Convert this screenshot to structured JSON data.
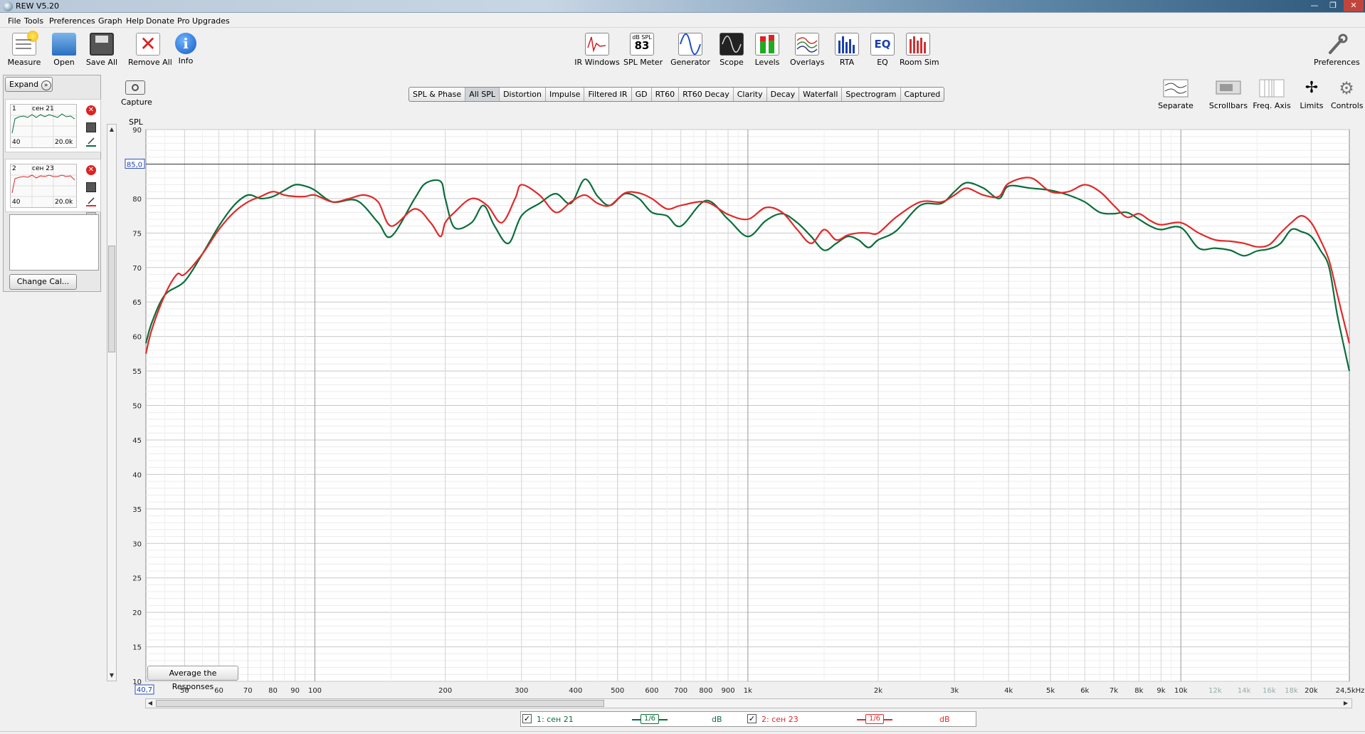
{
  "window": {
    "title": "REW V5.20"
  },
  "menu": [
    "File",
    "Tools",
    "Preferences",
    "Graph",
    "Help",
    "Donate",
    "Pro Upgrades"
  ],
  "toolbar": {
    "left": [
      "Measure",
      "Open",
      "Save All",
      "Remove All",
      "Info"
    ],
    "center": [
      "IR Windows",
      "SPL Meter",
      "Generator",
      "Scope",
      "Levels",
      "Overlays",
      "RTA",
      "EQ",
      "Room Sim"
    ],
    "right": "Preferences",
    "spl_meter_badge": {
      "top": "dB SPL",
      "value": "83"
    }
  },
  "side": {
    "expand": "Expand",
    "measurements": [
      {
        "num": "1",
        "name": "сен 21",
        "xmin": "40",
        "xmax": "20.0k",
        "color": "#0a6e3c"
      },
      {
        "num": "2",
        "name": "сен 23",
        "xmin": "40",
        "xmax": "20.0k",
        "color": "#e02a2a"
      }
    ],
    "change_cal": "Change Cal..."
  },
  "capture": "Capture",
  "tabs": [
    "SPL & Phase",
    "All SPL",
    "Distortion",
    "Impulse",
    "Filtered IR",
    "GD",
    "RT60",
    "RT60 Decay",
    "Clarity",
    "Decay",
    "Waterfall",
    "Spectrogram",
    "Captured"
  ],
  "active_tab": "All SPL",
  "graph_controls": [
    "Separate",
    "Scrollbars",
    "Freq. Axis",
    "Limits",
    "Controls"
  ],
  "avg_button": "Average the Responses",
  "legend": [
    {
      "check": "✓",
      "label": "1: сен 21",
      "smooth": "1/6",
      "unit": "dB",
      "color": "#0a6e3c"
    },
    {
      "check": "✓",
      "label": "2: сен 23",
      "smooth": "1/6",
      "unit": "dB",
      "color": "#e02a2a"
    }
  ],
  "chart_data": {
    "type": "line",
    "ylabel": "SPL",
    "xlim": [
      40.7,
      24500
    ],
    "ylim": [
      10,
      90
    ],
    "x_scale": "log",
    "x_cursor_label": "40,7",
    "y_cursor_label": "85,0",
    "y_cursor_value": 85,
    "xunit_label": "24,5kHz",
    "yticks": [
      10,
      15,
      20,
      25,
      30,
      35,
      40,
      45,
      50,
      55,
      60,
      65,
      70,
      75,
      80,
      85,
      90
    ],
    "xticks": [
      {
        "v": 50,
        "t": "50"
      },
      {
        "v": 60,
        "t": "60"
      },
      {
        "v": 70,
        "t": "70"
      },
      {
        "v": 80,
        "t": "80"
      },
      {
        "v": 90,
        "t": "90"
      },
      {
        "v": 100,
        "t": "100"
      },
      {
        "v": 200,
        "t": "200"
      },
      {
        "v": 300,
        "t": "300"
      },
      {
        "v": 400,
        "t": "400"
      },
      {
        "v": 500,
        "t": "500"
      },
      {
        "v": 600,
        "t": "600"
      },
      {
        "v": 700,
        "t": "700"
      },
      {
        "v": 800,
        "t": "800"
      },
      {
        "v": 900,
        "t": "900"
      },
      {
        "v": 1000,
        "t": "1k"
      },
      {
        "v": 2000,
        "t": "2k"
      },
      {
        "v": 3000,
        "t": "3k"
      },
      {
        "v": 4000,
        "t": "4k"
      },
      {
        "v": 5000,
        "t": "5k"
      },
      {
        "v": 6000,
        "t": "6k"
      },
      {
        "v": 7000,
        "t": "7k"
      },
      {
        "v": 8000,
        "t": "8k"
      },
      {
        "v": 9000,
        "t": "9k"
      },
      {
        "v": 10000,
        "t": "10k"
      },
      {
        "v": 12000,
        "t": "12k",
        "dim": true
      },
      {
        "v": 14000,
        "t": "14k",
        "dim": true
      },
      {
        "v": 16000,
        "t": "16k",
        "dim": true
      },
      {
        "v": 18000,
        "t": "18k",
        "dim": true
      },
      {
        "v": 20000,
        "t": "20k"
      }
    ],
    "series": [
      {
        "name": "1: сен 21",
        "color": "#0a6e3c",
        "x": [
          40.7,
          42,
          45,
          50,
          55,
          60,
          65,
          70,
          75,
          80,
          85,
          90,
          95,
          100,
          110,
          125,
          140,
          150,
          170,
          180,
          195,
          200,
          210,
          230,
          245,
          260,
          280,
          300,
          330,
          360,
          390,
          420,
          450,
          480,
          520,
          560,
          600,
          650,
          700,
          800,
          900,
          1000,
          1100,
          1200,
          1300,
          1400,
          1500,
          1600,
          1700,
          1800,
          1900,
          2000,
          2200,
          2500,
          2800,
          3000,
          3200,
          3500,
          3800,
          4000,
          4500,
          5000,
          5500,
          6000,
          6500,
          7000,
          7500,
          8000,
          8500,
          9000,
          10000,
          11000,
          12000,
          13000,
          14000,
          15000,
          16000,
          17000,
          18000,
          19000,
          20000,
          21000,
          22000,
          23000,
          24500
        ],
        "y": [
          59,
          62,
          66,
          68,
          72,
          76,
          79,
          80.5,
          80,
          80.3,
          81.2,
          82,
          81.8,
          81.2,
          79.5,
          79.7,
          76.5,
          74.5,
          80,
          82.2,
          82.5,
          80,
          75.8,
          76.5,
          79,
          76,
          73.5,
          77.5,
          79.3,
          80.7,
          79.3,
          82.8,
          80.3,
          79,
          80.7,
          80,
          78,
          77.5,
          76,
          79.7,
          77,
          74.5,
          76.8,
          77.8,
          76.5,
          74.5,
          72.5,
          73.5,
          74.5,
          74,
          72.9,
          74,
          75.3,
          79,
          79.3,
          81,
          82.3,
          81.5,
          80,
          81.8,
          81.5,
          81.2,
          80.5,
          79.5,
          78,
          77.8,
          78,
          77,
          76,
          75.5,
          75.8,
          72.8,
          72.8,
          72.5,
          71.7,
          72.4,
          72.7,
          73.5,
          75.5,
          75.2,
          74.5,
          72.5,
          70,
          63,
          55
        ]
      },
      {
        "name": "2: сен 23",
        "color": "#e02a2a",
        "x": [
          40.7,
          42,
          45,
          48,
          50,
          55,
          60,
          65,
          70,
          75,
          80,
          85,
          90,
          95,
          100,
          110,
          120,
          130,
          140,
          150,
          170,
          185,
          195,
          200,
          210,
          230,
          250,
          270,
          290,
          300,
          330,
          360,
          390,
          420,
          450,
          480,
          520,
          560,
          600,
          650,
          700,
          800,
          900,
          1000,
          1100,
          1200,
          1300,
          1400,
          1500,
          1600,
          1700,
          1800,
          1900,
          2000,
          2200,
          2500,
          2800,
          3000,
          3200,
          3500,
          3800,
          4000,
          4500,
          5000,
          5500,
          6000,
          6500,
          7000,
          7500,
          8000,
          8500,
          9000,
          10000,
          11000,
          12000,
          13000,
          14000,
          15000,
          16000,
          17000,
          18000,
          19000,
          20000,
          21000,
          22000,
          23000,
          24500
        ],
        "y": [
          57.5,
          61,
          66,
          69,
          69,
          72,
          75.5,
          78,
          79.5,
          80.3,
          81,
          80.5,
          80.3,
          80.3,
          80.5,
          79.5,
          80,
          80.5,
          79.5,
          76,
          78.5,
          76.5,
          74.5,
          76.5,
          78,
          80,
          79,
          76.5,
          80,
          82,
          80.5,
          78,
          79.5,
          80.5,
          79.3,
          79,
          80.8,
          80.8,
          80,
          78.5,
          79,
          79.5,
          77.7,
          77,
          78.7,
          78,
          75.5,
          73.5,
          75.5,
          74,
          74.7,
          75,
          75,
          75,
          77.3,
          79.5,
          79.5,
          80.5,
          81.5,
          80.5,
          80.3,
          82.2,
          83,
          81,
          81,
          82,
          81,
          79,
          77.3,
          77.8,
          76.8,
          76.2,
          76.5,
          75,
          74,
          73.8,
          73.5,
          73,
          73.3,
          75,
          76.5,
          77.5,
          76.5,
          74,
          71,
          66,
          59
        ]
      }
    ]
  }
}
